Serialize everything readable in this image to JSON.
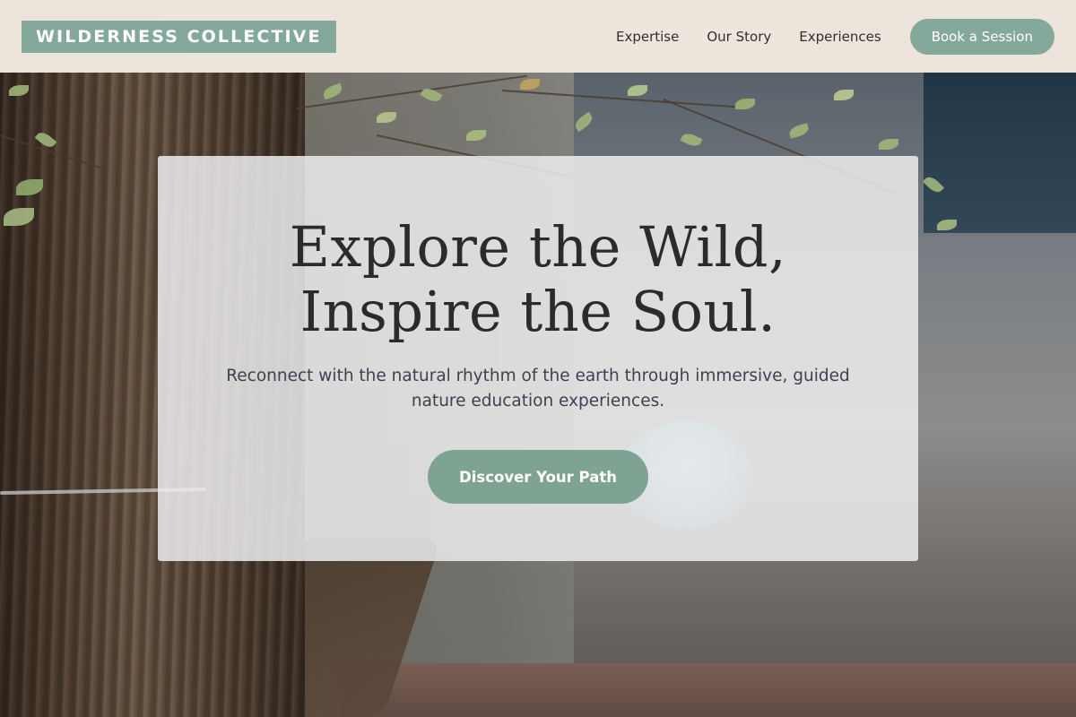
{
  "header": {
    "logo_text": "WILDERNESS COLLECTIVE",
    "nav": [
      {
        "label": "Expertise"
      },
      {
        "label": "Our Story"
      },
      {
        "label": "Experiences"
      }
    ],
    "book_button_label": "Book a Session"
  },
  "hero": {
    "title_line_1": "Explore the Wild,",
    "title_line_2": "Inspire the Soul.",
    "subtitle": "Reconnect with the natural rhythm of the earth through immersive, guided nature education experiences.",
    "cta_label": "Discover Your Path",
    "background_icon": "forest-photo"
  },
  "colors": {
    "accent": "#84a89a",
    "header_bg": "#f4ece2",
    "title_text": "#2b2b2b",
    "body_text": "#3c4250",
    "card_bg": "#ececee"
  }
}
